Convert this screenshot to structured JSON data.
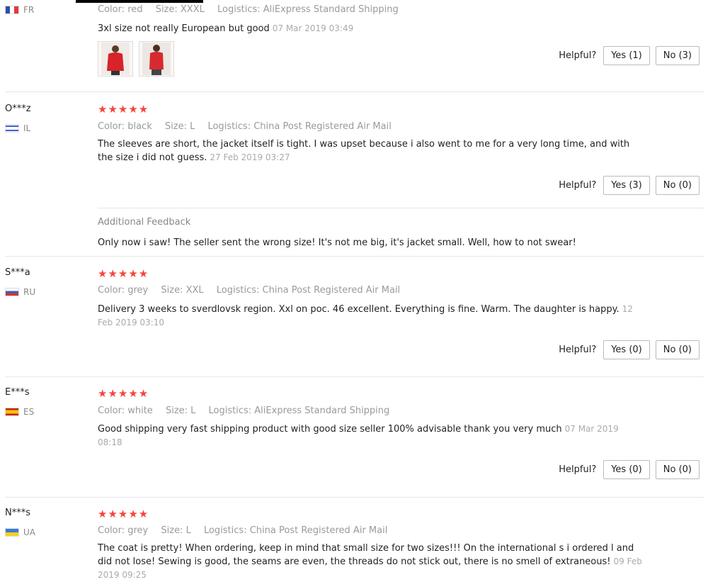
{
  "helpful_label": "Helpful?",
  "additional_feedback_label": "Additional Feedback",
  "reviews": [
    {
      "country": "FR",
      "meta": {
        "color": "Color: red",
        "size": "Size: XXXL",
        "logistics": "Logistics: AliExpress Standard Shipping"
      },
      "text": "3xl size not really European but good",
      "date": "07 Mar 2019 03:49",
      "yes": "Yes (1)",
      "no": "No (3)"
    },
    {
      "user": "O***z",
      "country": "IL",
      "stars": "★★★★★",
      "meta": {
        "color": "Color: black",
        "size": "Size: L",
        "logistics": "Logistics: China Post Registered Air Mail"
      },
      "text": "The sleeves are short, the jacket itself is tight. I was upset because i also went to me for a very long time, and with the size i did not guess.",
      "date": "27 Feb 2019 03:27",
      "yes": "Yes (3)",
      "no": "No (0)",
      "additional": "Only now i saw! The seller sent the wrong size! It's not me big, it's jacket small. Well, how to not swear!"
    },
    {
      "user": "S***a",
      "country": "RU",
      "stars": "★★★★★",
      "meta": {
        "color": "Color: grey",
        "size": "Size: XXL",
        "logistics": "Logistics: China Post Registered Air Mail"
      },
      "text": "Delivery 3 weeks to sverdlovsk region. Xxl on poc. 46 excellent. Everything is fine. Warm. The daughter is happy.",
      "date": "12 Feb 2019 03:10",
      "yes": "Yes (0)",
      "no": "No (0)"
    },
    {
      "user": "E***s",
      "country": "ES",
      "stars": "★★★★★",
      "meta": {
        "color": "Color: white",
        "size": "Size: L",
        "logistics": "Logistics: AliExpress Standard Shipping"
      },
      "text": "Good shipping very fast shipping product with good size seller 100% advisable thank you very much",
      "date": "07 Mar 2019 08:18",
      "yes": "Yes (0)",
      "no": "No (0)"
    },
    {
      "user": "N***s",
      "country": "UA",
      "stars": "★★★★★",
      "meta": {
        "color": "Color: grey",
        "size": "Size: L",
        "logistics": "Logistics: China Post Registered Air Mail"
      },
      "text": "The coat is pretty! When ordering, keep in mind that small size for two sizes!!! On the international s i ordered l and did not lose! Sewing is good, the seams are even, the threads do not stick out, there is no smell of extraneous!",
      "date": "09 Feb 2019 09:25"
    }
  ]
}
